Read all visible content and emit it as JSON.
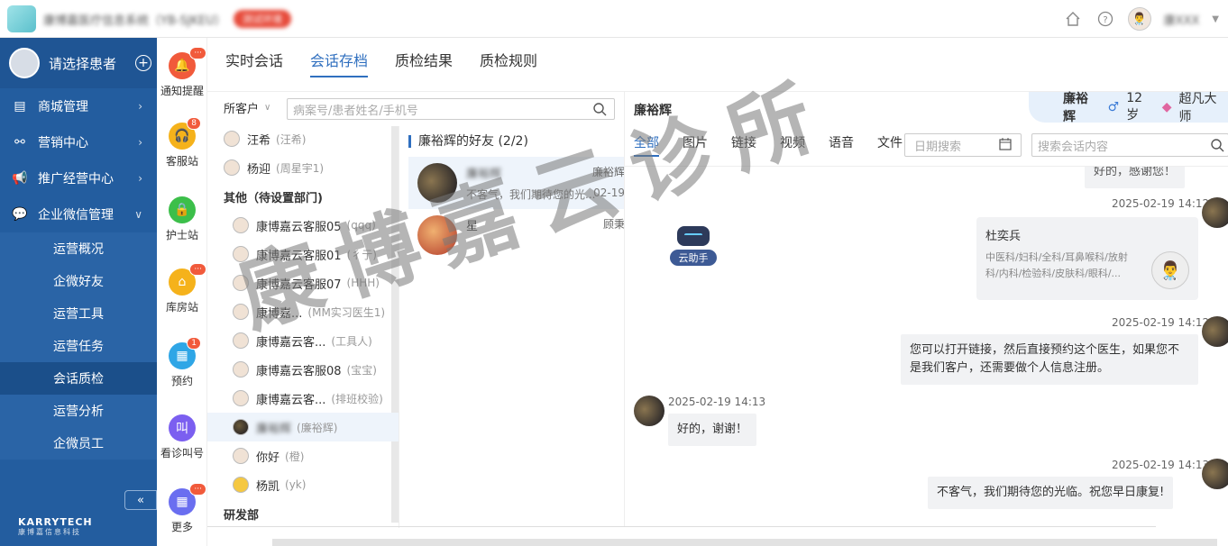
{
  "header": {
    "system_name": "康博嘉医疗信息系统（YB-SJKEU）",
    "env_badge": "测试环境",
    "user_name": "康XXX"
  },
  "sidebar": {
    "patient_label": "请选择患者",
    "menu": [
      {
        "label": "商城管理",
        "icon": "shop-icon"
      },
      {
        "label": "营销中心",
        "icon": "share-icon"
      },
      {
        "label": "推广经营中心",
        "icon": "megaphone-icon"
      },
      {
        "label": "企业微信管理",
        "icon": "wechat-icon"
      }
    ],
    "submenu": [
      "运营概况",
      "企微好友",
      "运营工具",
      "运营任务",
      "会话质检",
      "运营分析",
      "企微员工"
    ],
    "active_submenu": "会话质检",
    "collapse_label": "«",
    "brand_name": "KARRYTECH",
    "brand_sub": "康博嘉信息科技"
  },
  "rail": [
    {
      "label": "通知提醒",
      "icon": "bell-icon",
      "badge": "···",
      "color": "#f15a3b"
    },
    {
      "label": "客服站",
      "icon": "headset-icon",
      "badge": "8",
      "color": "#f5b21b"
    },
    {
      "label": "护士站",
      "icon": "lock-icon",
      "badge": "",
      "color": "#3cbf4a"
    },
    {
      "label": "库房站",
      "icon": "home-icon",
      "badge": "···",
      "color": "#f5b21b"
    },
    {
      "label": "预约",
      "icon": "calendar-icon",
      "badge": "1",
      "color": "#2fa6e6"
    },
    {
      "label": "看诊叫号",
      "icon": "call-icon",
      "badge": "",
      "color": "#7b5ff0"
    },
    {
      "label": "更多",
      "icon": "grid-icon",
      "badge": "···",
      "color": "#6a6ef0"
    }
  ],
  "tabs": [
    "实时会话",
    "会话存档",
    "质检结果",
    "质检规则"
  ],
  "active_tab": "会话存档",
  "contacts": {
    "filter_label": "所客户",
    "search_placeholder": "病案号/患者姓名/手机号",
    "items": [
      {
        "type": "row",
        "name": "汪希",
        "sub": "(汪希)",
        "avatar": "doc"
      },
      {
        "type": "row",
        "name": "杨迎",
        "sub": "(周星宇1)",
        "avatar": "doc"
      },
      {
        "type": "group",
        "name": "其他（待设置部门)"
      },
      {
        "type": "row",
        "name": "康博嘉云客服05",
        "sub": "(qqq)",
        "avatar": "doc"
      },
      {
        "type": "row",
        "name": "康博嘉云客服01",
        "sub": "(彳亍)",
        "avatar": "doc"
      },
      {
        "type": "row",
        "name": "康博嘉云客服07",
        "sub": "(HHH)",
        "avatar": "doc"
      },
      {
        "type": "row",
        "name": "康博嘉...",
        "sub": "(MM实习医生1)",
        "avatar": "doc"
      },
      {
        "type": "row",
        "name": "康博嘉云客...",
        "sub": "(工具人)",
        "avatar": "doc"
      },
      {
        "type": "row",
        "name": "康博嘉云客服08",
        "sub": "(宝宝)",
        "avatar": "doc"
      },
      {
        "type": "row",
        "name": "康博嘉云客...",
        "sub": "(排班校验)",
        "avatar": "doc"
      },
      {
        "type": "row",
        "name": "廉裕辉",
        "sub": "(廉裕辉)",
        "avatar": "dark",
        "blur": true,
        "selected": true
      },
      {
        "type": "row",
        "name": "你好",
        "sub": "(橙)",
        "avatar": "doc"
      },
      {
        "type": "row",
        "name": "杨凯",
        "sub": "(yk)",
        "avatar": "yk"
      },
      {
        "type": "group",
        "name": "研发部"
      }
    ]
  },
  "friends": {
    "header": "廉裕辉的好友 (2/2)",
    "items": [
      {
        "name": "廉裕辉",
        "tag": "廉裕辉",
        "msg": "不客气，我们期待您的光...",
        "date": "02-19",
        "blur": true
      },
      {
        "name": "星",
        "tag": "顾秉",
        "msg": "",
        "date": ""
      }
    ]
  },
  "chat": {
    "title": "廉裕辉",
    "info_name": "廉裕辉",
    "info_age": "12岁",
    "info_level": "超凡大师",
    "filter_tabs": [
      "全部",
      "图片",
      "链接",
      "视频",
      "语音",
      "文件"
    ],
    "active_filter": "全部",
    "date_placeholder": "日期搜索",
    "search_placeholder": "搜索会话内容",
    "robot_label": "云助手",
    "partial_top": "好的，感谢您！",
    "messages": [
      {
        "ts": "2025-02-19 14:12",
        "side": "right",
        "card_title": "杜奕兵",
        "card_desc": "中医科/妇科/全科/耳鼻喉科/放射科/内科/检验科/皮肤科/眼科/..."
      },
      {
        "ts": "2025-02-19 14:12",
        "side": "right",
        "text": "您可以打开链接，然后直接预约这个医生，如果您不是我们客户，还需要做个人信息注册。"
      },
      {
        "ts": "2025-02-19 14:13",
        "side": "left",
        "text": "好的，谢谢！"
      },
      {
        "ts": "2025-02-19 14:13",
        "side": "right",
        "text": "不客气，我们期待您的光临。祝您早日康复!"
      }
    ]
  },
  "watermark": "康博嘉云诊所"
}
